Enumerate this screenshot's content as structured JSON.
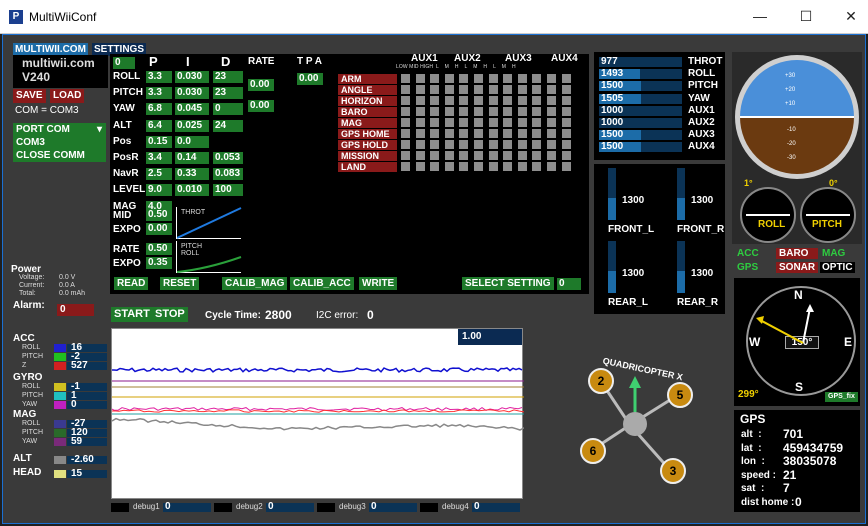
{
  "window": {
    "title": "MultiWiiConf",
    "minimize": "—",
    "maximize": "☐",
    "close": "✕"
  },
  "tabs": {
    "multiwii": "MULTIWII.COM",
    "settings": "SETTINGS"
  },
  "header": {
    "site": "multiwii.com",
    "version": "V240"
  },
  "buttons": {
    "save": "SAVE",
    "load": "LOAD",
    "read": "READ",
    "reset": "RESET",
    "calib_mag": "CALIB_MAG",
    "calib_acc": "CALIB_ACC",
    "write": "WRITE",
    "select_setting": "SELECT SETTING",
    "start": "START",
    "stop": "STOP"
  },
  "com": {
    "current": "COM = COM3",
    "port_label": "PORT COM",
    "port_item": "COM3",
    "close": "CLOSE COMM"
  },
  "pid": {
    "headers": [
      "P",
      "I",
      "D",
      "RATE",
      "T P A"
    ],
    "top_value": "0",
    "rows": [
      {
        "name": "ROLL",
        "p": "3.3",
        "i": "0.030",
        "d": "23"
      },
      {
        "name": "PITCH",
        "p": "3.3",
        "i": "0.030",
        "d": "23"
      },
      {
        "name": "YAW",
        "p": "6.8",
        "i": "0.045",
        "d": "0"
      },
      {
        "name": "ALT",
        "p": "6.4",
        "i": "0.025",
        "d": "24"
      },
      {
        "name": "Pos",
        "p": "0.15",
        "i": "0.0",
        "d": ""
      },
      {
        "name": "PosR",
        "p": "3.4",
        "i": "0.14",
        "d": "0.053"
      },
      {
        "name": "NavR",
        "p": "2.5",
        "i": "0.33",
        "d": "0.083"
      },
      {
        "name": "LEVEL",
        "p": "9.0",
        "i": "0.010",
        "d": "100"
      },
      {
        "name": "MAG",
        "p": "4.0",
        "i": "",
        "d": ""
      }
    ],
    "rate_rollpitch": "0.00",
    "rate_yaw": "0.00",
    "tpa": "0.00",
    "mid_label": "MID",
    "mid": "0.50",
    "expo_label": "EXPO",
    "expo": "0.00",
    "throt_label": "THROT",
    "rate_label": "RATE",
    "rate": "0.50",
    "expo2_label": "EXPO",
    "expo2": "0.35",
    "pitch_roll_label": "PITCH\nROLL"
  },
  "aux": {
    "headers": [
      "AUX1",
      "AUX2",
      "AUX3",
      "AUX4"
    ],
    "sub": "LOW MID HIGH  L    M    H    L    M    H    L    M    H",
    "modes": [
      "ARM",
      "ANGLE",
      "HORIZON",
      "BARO",
      "MAG",
      "GPS HOME",
      "GPS HOLD",
      "MISSION",
      "LAND"
    ]
  },
  "select_setting_value": "0",
  "rc": [
    {
      "value": "977",
      "name": "THROT",
      "frac": 0.0
    },
    {
      "value": "1493",
      "name": "ROLL",
      "frac": 0.49
    },
    {
      "value": "1500",
      "name": "PITCH",
      "frac": 0.5
    },
    {
      "value": "1505",
      "name": "YAW",
      "frac": 0.5
    },
    {
      "value": "1000",
      "name": "AUX1",
      "frac": 0.0
    },
    {
      "value": "1000",
      "name": "AUX2",
      "frac": 0.0
    },
    {
      "value": "1500",
      "name": "AUX3",
      "frac": 0.5
    },
    {
      "value": "1500",
      "name": "AUX4",
      "frac": 0.5
    }
  ],
  "motors": [
    {
      "value": "1300",
      "name": "FRONT_L"
    },
    {
      "value": "1300",
      "name": "FRONT_R"
    },
    {
      "value": "1300",
      "name": "REAR_L"
    },
    {
      "value": "1300",
      "name": "REAR_R"
    }
  ],
  "attitude": {
    "roll_deg": "1°",
    "pitch_deg": "0°",
    "roll_label": "ROLL",
    "pitch_label": "PITCH",
    "ticks": [
      "+30",
      "+20",
      "+10",
      "-10",
      "-20",
      "-30"
    ]
  },
  "sensors": {
    "acc": "ACC",
    "baro": "BARO",
    "mag": "MAG",
    "gps": "GPS",
    "sonar": "SONAR",
    "optic": "OPTIC"
  },
  "compass": {
    "n": "N",
    "s": "S",
    "e": "E",
    "w": "W",
    "heading": "150°",
    "gps_heading": "299°",
    "gps_fix": "GPS_fix"
  },
  "gps": {
    "title": "GPS",
    "rows": [
      {
        "label": "alt  :",
        "value": "701"
      },
      {
        "label": "lat  :",
        "value": "459434759"
      },
      {
        "label": "lon  :",
        "value": "38035078"
      },
      {
        "label": "speed :",
        "value": "21"
      },
      {
        "label": "sat  :",
        "value": "7"
      },
      {
        "label": "dist home :",
        "value": "0"
      }
    ]
  },
  "power": {
    "title": "Power",
    "voltage_label": "Voltage:",
    "voltage": "0.0 V",
    "current_label": "Current:",
    "current": "0.0 A",
    "total_label": "Total:",
    "total": "0.0 mAh",
    "alarm_label": "Alarm:",
    "alarm": "0"
  },
  "status": {
    "cycle_label": "Cycle Time:",
    "cycle": "2800",
    "i2c_label": "I2C error:",
    "i2c": "0"
  },
  "graph": {
    "scale": "1.00"
  },
  "sensor_values": {
    "acc": {
      "title": "ACC",
      "roll": "16",
      "pitch": "-2",
      "z": "527"
    },
    "gyro": {
      "title": "GYRO",
      "roll": "-1",
      "pitch": "1",
      "yaw": "0"
    },
    "mag": {
      "title": "MAG",
      "roll": "-27",
      "pitch": "120",
      "yaw": "59"
    },
    "alt": {
      "title": "ALT",
      "value": "-2.60"
    },
    "head": {
      "title": "HEAD",
      "value": "15"
    },
    "labels": {
      "roll": "ROLL",
      "pitch": "PITCH",
      "z": "Z",
      "yaw": "YAW"
    }
  },
  "debug": [
    {
      "label": "debug1",
      "value": "0"
    },
    {
      "label": "debug2",
      "value": "0"
    },
    {
      "label": "debug3",
      "value": "0"
    },
    {
      "label": "debug4",
      "value": "0"
    }
  ],
  "quad": {
    "label": "QUADRICOPTER X",
    "motors": [
      "2",
      "5",
      "6",
      "3"
    ]
  },
  "colors": {
    "green": "#1e7a2a",
    "red": "#8a1a1a",
    "blue_sel": "#1c6ca8"
  }
}
